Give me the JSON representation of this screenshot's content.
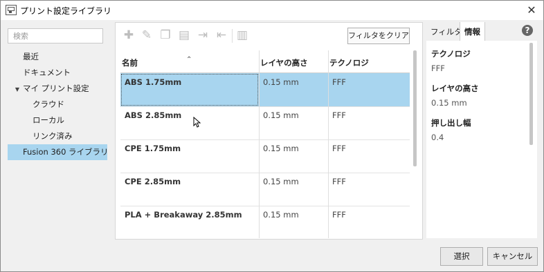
{
  "window": {
    "title": "プリント設定ライブラリ",
    "close_glyph": "✕"
  },
  "sidebar": {
    "search_placeholder": "検索",
    "items": [
      {
        "label": "最近"
      },
      {
        "label": "ドキュメント"
      },
      {
        "label": "マイ プリント設定",
        "expanded": true
      },
      {
        "label": "クラウド"
      },
      {
        "label": "ローカル"
      },
      {
        "label": "リンク済み"
      },
      {
        "label": "Fusion 360 ライブラリ",
        "selected": true
      }
    ]
  },
  "toolbar": {
    "icons": [
      "plus-icon",
      "edit-icon",
      "copy-icon",
      "paste-icon",
      "import-icon",
      "export-icon",
      "delete-icon"
    ],
    "clear_filter_label": "フィルタをクリア"
  },
  "table": {
    "columns": [
      "名前",
      "レイヤの高さ",
      "テクノロジ"
    ],
    "rows": [
      {
        "name": "ABS 1.75mm",
        "layer": "0.15 mm",
        "tech": "FFF",
        "selected": true
      },
      {
        "name": "ABS 2.85mm",
        "layer": "0.15 mm",
        "tech": "FFF"
      },
      {
        "name": "CPE 1.75mm",
        "layer": "0.15 mm",
        "tech": "FFF"
      },
      {
        "name": "CPE 2.85mm",
        "layer": "0.15 mm",
        "tech": "FFF"
      },
      {
        "name": "PLA + Breakaway 2.85mm",
        "layer": "0.15 mm",
        "tech": "FFF"
      }
    ]
  },
  "panel": {
    "tabs": [
      {
        "label": "フィルタ"
      },
      {
        "label": "情報",
        "active": true
      }
    ],
    "help_glyph": "?",
    "props": [
      {
        "label": "テクノロジ",
        "value": "FFF"
      },
      {
        "label": "レイヤの高さ",
        "value": "0.15 mm"
      },
      {
        "label": "押し出し幅",
        "value": "0.4"
      }
    ]
  },
  "footer": {
    "ok_label": "選択",
    "cancel_label": "キャンセル"
  },
  "colors": {
    "selection": "#a8d5ef"
  }
}
